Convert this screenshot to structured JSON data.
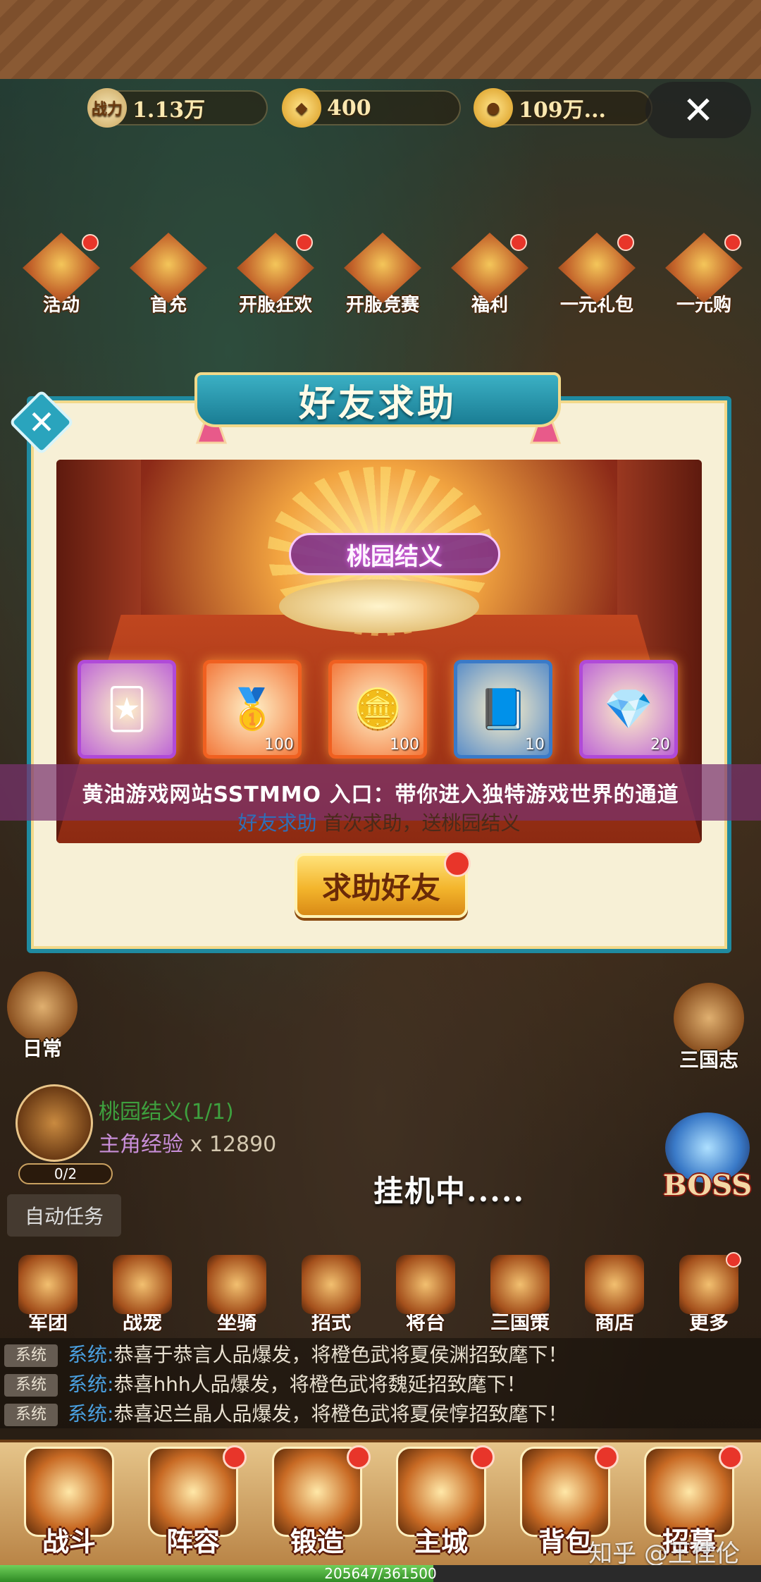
{
  "resources": {
    "combat_power_label": "战力",
    "combat_power": "1.13万",
    "gold_ingot": "400",
    "coins": "109万..."
  },
  "events": [
    {
      "label": "活动",
      "badge": true
    },
    {
      "label": "首充",
      "badge": false
    },
    {
      "label": "开服狂欢",
      "badge": true
    },
    {
      "label": "开服竞赛",
      "badge": false
    },
    {
      "label": "福利",
      "badge": true
    },
    {
      "label": "一元礼包",
      "badge": true
    },
    {
      "label": "一元购",
      "badge": true
    }
  ],
  "dialog": {
    "title": "好友求助",
    "stage_title": "桃园结义",
    "rewards": [
      {
        "icon": "card-icon",
        "glyph": "🃏",
        "qty": "",
        "border": "#b04ad8"
      },
      {
        "icon": "gold-ingot-icon",
        "glyph": "🥇",
        "qty": "100",
        "border": "#f06020"
      },
      {
        "icon": "coin-icon",
        "glyph": "🪙",
        "qty": "100",
        "border": "#f06020"
      },
      {
        "icon": "exp-book-icon",
        "glyph": "📘",
        "qty": "10",
        "border": "#3a7ac8"
      },
      {
        "icon": "gem-icon",
        "glyph": "💎",
        "qty": "20",
        "border": "#b04ad8"
      }
    ],
    "help_key": "好友求助",
    "help_value": "首次求助，送桃园结义",
    "button_label": "求助好友"
  },
  "headline": "黄油游戏网站SSTMMO 入口：带你进入独特游戏世界的通道",
  "side": {
    "daily": "日常",
    "three_kingdoms": "三国志"
  },
  "quest": {
    "progress": "0/2",
    "name": "桃园结义(1/1)",
    "reward_key": "主角经验",
    "reward_value": "x 12890"
  },
  "auto_task": "自动任务",
  "idle_text": "挂机中.....",
  "boss_text": "BOSS",
  "features": [
    {
      "label": "军团",
      "badge": false
    },
    {
      "label": "战宠",
      "badge": false
    },
    {
      "label": "坐骑",
      "badge": false
    },
    {
      "label": "招式",
      "badge": false
    },
    {
      "label": "将台",
      "badge": false
    },
    {
      "label": "三国策",
      "badge": false
    },
    {
      "label": "商店",
      "badge": false
    },
    {
      "label": "更多",
      "badge": true
    }
  ],
  "chat": [
    {
      "tag": "系统",
      "src": "系统:",
      "msg": "恭喜于恭言人品爆发，将橙色武将夏侯渊招致麾下！"
    },
    {
      "tag": "系统",
      "src": "系统:",
      "msg": "恭喜hhh人品爆发，将橙色武将魏延招致麾下！"
    },
    {
      "tag": "系统",
      "src": "系统:",
      "msg": "恭喜迟兰晶人品爆发，将橙色武将夏侯惇招致麾下！"
    }
  ],
  "nav": [
    {
      "label": "战斗",
      "badge": false
    },
    {
      "label": "阵容",
      "badge": true
    },
    {
      "label": "锻造",
      "badge": true
    },
    {
      "label": "主城",
      "badge": true
    },
    {
      "label": "背包",
      "badge": true
    },
    {
      "label": "招募",
      "badge": true
    }
  ],
  "exp": {
    "text": "205647/361500",
    "fraction": 0.569
  },
  "watermark": "知乎 @王佳伦"
}
